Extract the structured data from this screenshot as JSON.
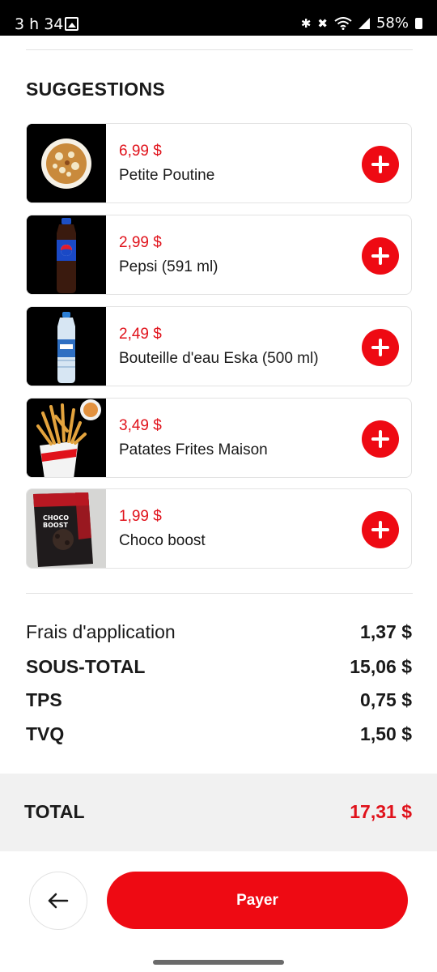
{
  "status_bar": {
    "time": "3 h 34",
    "icons": [
      "gallery-icon",
      "bluetooth-icon",
      "mute-icon",
      "wifi-icon",
      "signal-icon",
      "battery-icon"
    ],
    "battery": "58%"
  },
  "suggestions": {
    "title": "SUGGESTIONS",
    "items": [
      {
        "price": "6,99 $",
        "name": "Petite Poutine",
        "image": "poutine-image"
      },
      {
        "price": "2,99 $",
        "name": "Pepsi (591 ml)",
        "image": "pepsi-bottle-image"
      },
      {
        "price": "2,49 $",
        "name": "Bouteille d'eau Eska (500 ml)",
        "image": "water-bottle-image"
      },
      {
        "price": "3,49 $",
        "name": "Patates Frites Maison",
        "image": "fries-image"
      },
      {
        "price": "1,99 $",
        "name": "Choco boost",
        "image": "choco-boost-image",
        "package_text": "CHOCO BOOST"
      }
    ]
  },
  "summary": {
    "rows": [
      {
        "label": "Frais d'application",
        "value": "1,37 $"
      },
      {
        "label": "SOUS-TOTAL",
        "value": "15,06 $"
      },
      {
        "label": "TPS",
        "value": "0,75 $"
      },
      {
        "label": "TVQ",
        "value": "1,50 $"
      }
    ],
    "total_label": "TOTAL",
    "total_value": "17,31 $"
  },
  "footer": {
    "back_icon": "arrow-left-icon",
    "pay_label": "Payer"
  },
  "colors": {
    "accent": "#ee0a13",
    "price": "#e0121b",
    "total_bg": "#f1f1f1"
  }
}
